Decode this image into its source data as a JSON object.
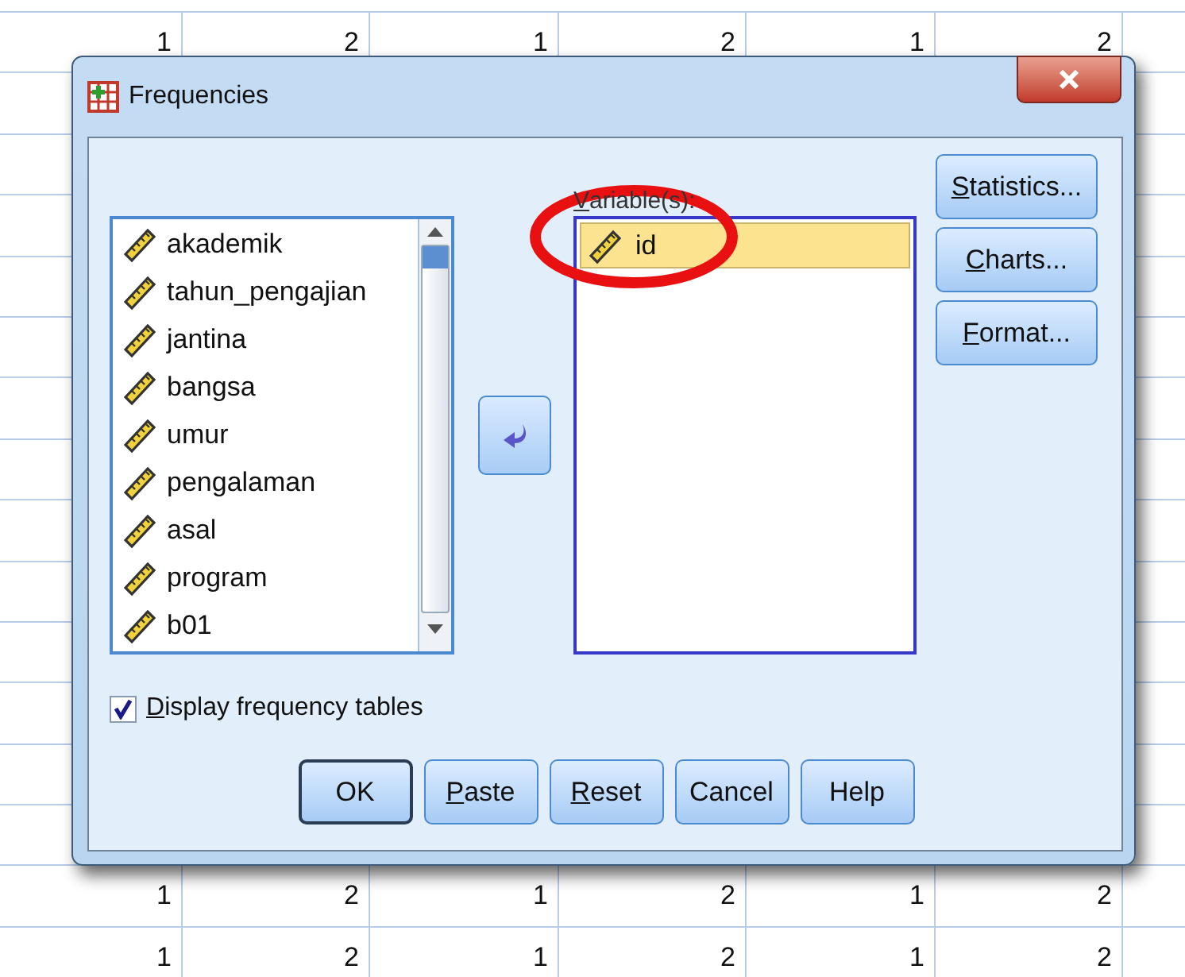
{
  "spreadsheet": {
    "top_row": [
      "1",
      "2",
      "1",
      "2",
      "1",
      "2"
    ],
    "bottom_rows": [
      [
        "1",
        "2",
        "1",
        "2",
        "1",
        "2"
      ],
      [
        "1",
        "2",
        "1",
        "2",
        "1",
        "2"
      ]
    ]
  },
  "dialog": {
    "title": "Frequencies",
    "source_list": [
      {
        "label": "akademik",
        "selected": false
      },
      {
        "label": "tahun_pengajian",
        "selected": false
      },
      {
        "label": "jantina",
        "selected": false
      },
      {
        "label": "bangsa",
        "selected": false
      },
      {
        "label": "umur",
        "selected": false
      },
      {
        "label": "pengalaman",
        "selected": false
      },
      {
        "label": "asal",
        "selected": false
      },
      {
        "label": "program",
        "selected": false
      },
      {
        "label": "b01",
        "selected": false
      }
    ],
    "target_label": "Variable(s):",
    "target_list": [
      {
        "label": "id",
        "selected": true
      }
    ],
    "side_buttons": [
      "Statistics...",
      "Charts...",
      "Format..."
    ],
    "checkbox": {
      "label": "Display frequency tables",
      "checked": true
    },
    "buttons": [
      {
        "label": "OK",
        "default": true
      },
      {
        "label": "Paste",
        "default": false
      },
      {
        "label": "Reset",
        "default": false
      },
      {
        "label": "Cancel",
        "default": false
      },
      {
        "label": "Help",
        "default": false
      }
    ]
  }
}
